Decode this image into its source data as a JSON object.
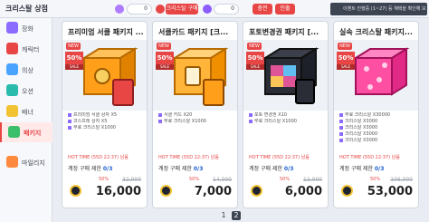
{
  "window": {
    "title": "크리스탈 상점"
  },
  "topbar": {
    "currency1_value": "0",
    "buy_crystal_label": "크리스탈 구매",
    "currency2_value": "0",
    "btn_a_label": "충전",
    "btn_b_label": "인출",
    "notice_text": "이벤트 진행중 (1~27) 등 혜택을 확인해 보세요"
  },
  "sidebar": {
    "items": [
      {
        "label": "장화",
        "color": "#8c6bff"
      },
      {
        "label": "캐릭터",
        "color": "#e84545"
      },
      {
        "label": "의상",
        "color": "#4aa3ff"
      },
      {
        "label": "오션",
        "color": "#2bbbad"
      },
      {
        "label": "배너",
        "color": "#f1c232"
      },
      {
        "label": "패키지",
        "color": "#3bbf6b",
        "active": true
      },
      {
        "label": "마일리지",
        "color": "#ff8a3d"
      }
    ]
  },
  "cards": [
    {
      "name": "프리미엄 서클 패키지 ...",
      "new_label": "NEW",
      "discount": "50%",
      "sale_label": "SALE",
      "items": [
        "프리미엄 서클 상자 X5",
        "코스프레 상자 X5",
        "무료 크리스탈 X1000"
      ],
      "hot": "HOT TIME (55D 22:37) 남음",
      "limit_label": "계정 구매 제한",
      "limit_value": "0/3",
      "old_price": "32,000",
      "discount_note": "50%",
      "price": "16,000",
      "art_color": "#ff9f1a"
    },
    {
      "name": "서클카드 패키지 [크...",
      "new_label": "NEW",
      "discount": "50%",
      "sale_label": "SALE",
      "items": [
        "서클 카드 X20",
        "무료 크리스탈 X1000"
      ],
      "hot": "HOT TIME (55D 22:37) 남음",
      "limit_label": "계정 구매 제한",
      "limit_value": "0/3",
      "old_price": "14,000",
      "discount_note": "50%",
      "price": "7,000",
      "art_color": "#ffb43a"
    },
    {
      "name": "포토변경권 패키지 [...",
      "new_label": "NEW",
      "discount": "50%",
      "sale_label": "SALE",
      "items": [
        "포토 변경권 X10",
        "무료 크리스탈 X1000"
      ],
      "hot": "HOT TIME (55D 22:37) 남음",
      "limit_label": "계정 구매 제한",
      "limit_value": "0/3",
      "old_price": "12,000",
      "discount_note": "50%",
      "price": "6,000",
      "art_color": "#2a2d36"
    },
    {
      "name": "실속 크리스탈 패키지...",
      "new_label": "NEW",
      "discount": "50%",
      "sale_label": "SALE",
      "items": [
        "무료 크리스탈 X30000",
        "크리스탈 X3000",
        "크리스탈 X3000",
        "크리스탈 X3000",
        "크리스탈 X3000"
      ],
      "hot": "HOT TIME (55D 22:37) 남음",
      "limit_label": "계정 구매 제한",
      "limit_value": "0/3",
      "old_price": "106,000",
      "discount_note": "50%",
      "price": "53,000",
      "art_color": "#ff4fa3"
    }
  ],
  "pager": {
    "pages": [
      "1",
      "2"
    ],
    "current": "2"
  }
}
